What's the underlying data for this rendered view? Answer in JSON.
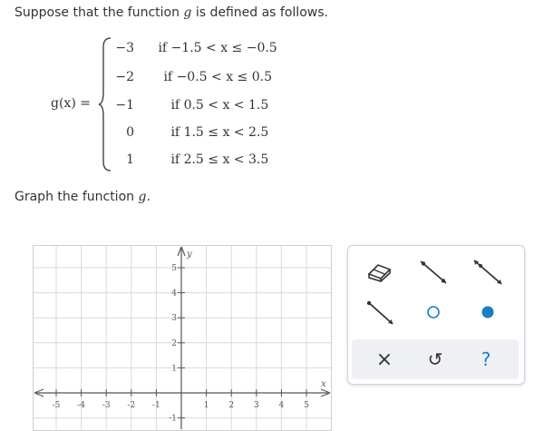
{
  "prompt": {
    "text_pre": "Suppose that the function ",
    "var": "g",
    "text_post": " is defined as follows."
  },
  "function_def": {
    "label": "g(x) =",
    "pieces": [
      {
        "value": "−3",
        "condition": "if −1.5 < x ≤ −0.5"
      },
      {
        "value": "−2",
        "condition": "if −0.5 < x ≤ 0.5"
      },
      {
        "value": "−1",
        "condition": "if 0.5 < x < 1.5"
      },
      {
        "value": "0",
        "condition": "if 1.5 ≤ x < 2.5"
      },
      {
        "value": "1",
        "condition": "if 2.5 ≤ x < 3.5"
      }
    ]
  },
  "instruction": {
    "text": "Graph the function ",
    "var": "g",
    "end": "."
  },
  "graph": {
    "x_ticks": [
      "-5",
      "-4",
      "-3",
      "-2",
      "-1",
      "1",
      "2",
      "3",
      "4",
      "5"
    ],
    "y_ticks": [
      "5",
      "4",
      "3",
      "2",
      "1",
      "-1"
    ],
    "x_axis_label": "x",
    "y_axis_label": "y",
    "grid_color": "#d9d9d9",
    "axis_color": "#555555"
  },
  "toolbox": {
    "tools": [
      "eraser-icon",
      "line-segment-icon",
      "ray-icon",
      "line-icon",
      "open-dot-icon",
      "closed-dot-icon"
    ],
    "actions": {
      "clear": "×",
      "undo": "↺",
      "help": "?"
    },
    "accent_color": "#1a7fc1"
  }
}
